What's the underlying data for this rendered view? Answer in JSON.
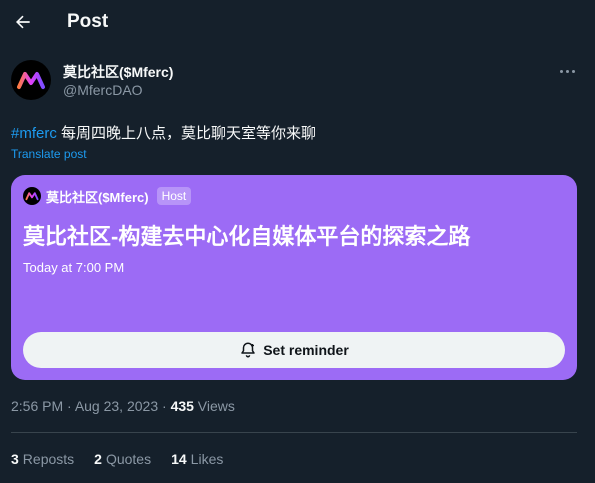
{
  "header": {
    "title": "Post",
    "back_icon": "arrow-left-icon"
  },
  "author": {
    "name": "莫比社区($Mferc)",
    "handle": "@MfercDAO",
    "avatar_icon": "mferc-logo-icon",
    "more_icon": "more-horizontal-icon"
  },
  "post": {
    "hashtag": "#mferc",
    "text": " 每周四晚上八点，莫比聊天室等你来聊",
    "translate_label": "Translate post"
  },
  "space_card": {
    "host_name": "莫比社区($Mferc)",
    "host_badge": "Host",
    "title": "莫比社区-构建去中心化自媒体平台的探索之路",
    "time": "Today at 7:00 PM",
    "reminder_label": "Set reminder",
    "reminder_icon": "alarm-bell-icon",
    "background_color": "#9c6bf5"
  },
  "meta": {
    "time": "2:56 PM",
    "separator": " · ",
    "date": "Aug 23, 2023",
    "views_count": "435",
    "views_label": " Views"
  },
  "stats": {
    "reposts_count": "3",
    "reposts_label": "Reposts",
    "quotes_count": "2",
    "quotes_label": "Quotes",
    "likes_count": "14",
    "likes_label": "Likes"
  },
  "colors": {
    "background": "#15202b",
    "link": "#1d9bf0",
    "muted": "#8b98a5",
    "card": "#9c6bf5"
  }
}
